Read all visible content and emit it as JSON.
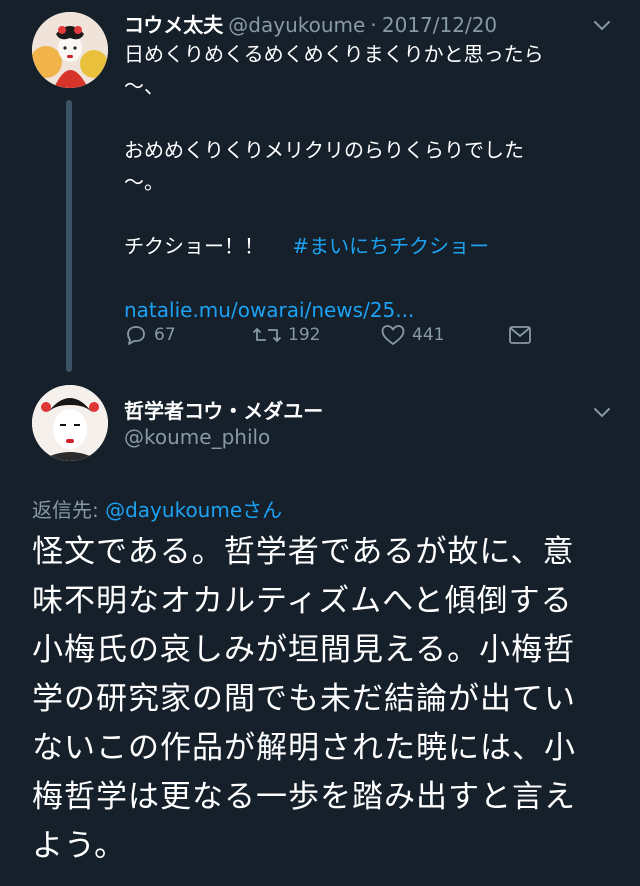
{
  "tweet1": {
    "display_name": "コウメ太夫",
    "handle": "@dayukoume",
    "separator": "·",
    "date": "2017/12/20",
    "lines": [
      "日めくりめくるめくめくりまくりかと思ったら",
      "〜、",
      "",
      "おめめくりくりメリクリのらりくらりでした",
      "〜。",
      "",
      "チクショー！！"
    ],
    "hashtag": "#まいにちチクショー",
    "link": "natalie.mu/owarai/news/25...",
    "actions": {
      "replies": "67",
      "retweets": "192",
      "likes": "441"
    }
  },
  "tweet2": {
    "display_name": "哲学者コウ・メダユー",
    "handle": "@koume_philo",
    "reply_prefix": "返信先:",
    "reply_handle": "@dayukoume",
    "reply_suffix": "さん",
    "body_lines": [
      "怪文である。哲学者であるが故に、意",
      "味不明なオカルティズムへと傾倒する",
      "小梅氏の哀しみが垣間見える。小梅哲",
      "学の研究家の間でも未だ結論が出てい",
      "ないこの作品が解明された暁には、小",
      "梅哲学は更なる一歩を踏み出すと言え",
      "よう。"
    ]
  },
  "icons": [
    "reply-icon",
    "retweet-icon",
    "like-icon",
    "dm-icon",
    "chevron-down-icon"
  ],
  "colors": {
    "background": "#15202b",
    "link": "#1da1f2",
    "muted": "#8899a6",
    "thread_line": "#3d5466"
  }
}
